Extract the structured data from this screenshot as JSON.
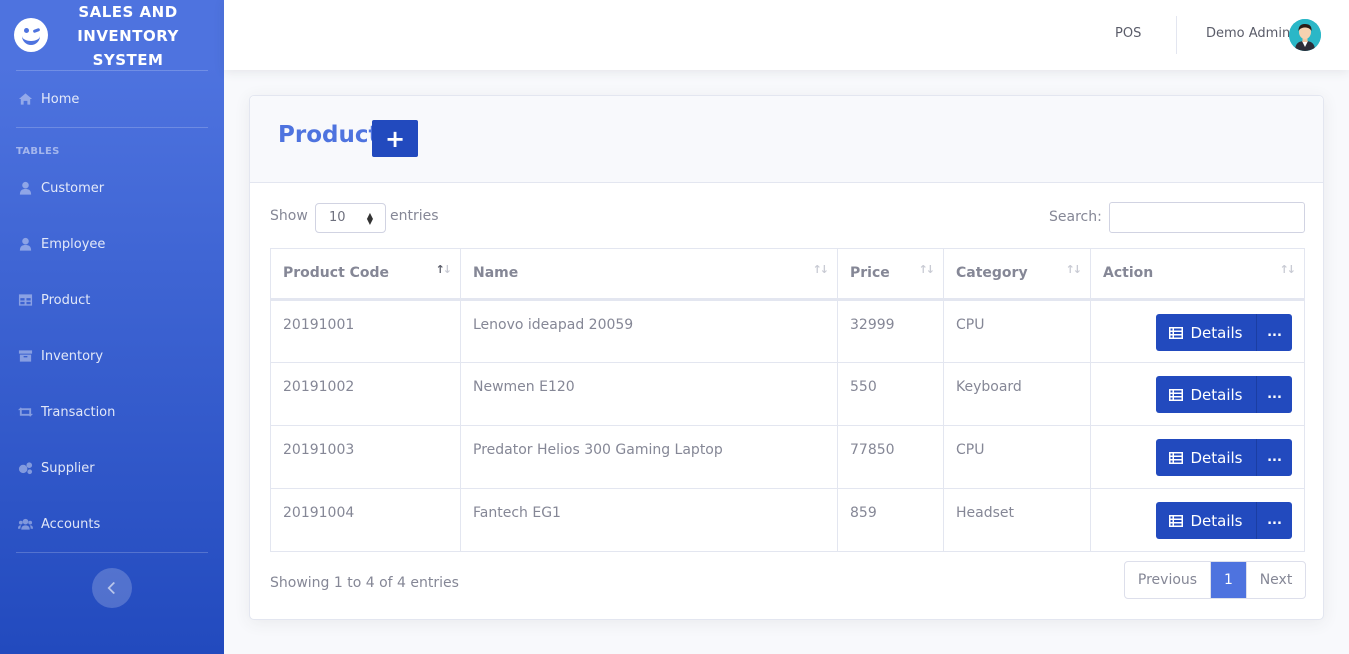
{
  "app": {
    "brand_line1": "SALES AND",
    "brand_line2": "INVENTORY",
    "brand_line3": "SYSTEM"
  },
  "sidebar": {
    "home": "Home",
    "section_heading": "TABLES",
    "items": [
      {
        "label": "Customer",
        "icon": "user-icon"
      },
      {
        "label": "Employee",
        "icon": "user-icon"
      },
      {
        "label": "Product",
        "icon": "table-icon"
      },
      {
        "label": "Inventory",
        "icon": "archive-icon"
      },
      {
        "label": "Transaction",
        "icon": "retweet-icon"
      },
      {
        "label": "Supplier",
        "icon": "cogs-icon"
      },
      {
        "label": "Accounts",
        "icon": "users-icon"
      }
    ]
  },
  "topbar": {
    "pos": "POS",
    "user_name": "Demo Admin"
  },
  "card": {
    "title": "Product",
    "add_button": "+"
  },
  "table_controls": {
    "show": "Show",
    "entries_value": "10",
    "entries": "entries",
    "search": "Search:",
    "search_value": ""
  },
  "table": {
    "columns": [
      "Product Code",
      "Name",
      "Price",
      "Category",
      "Action"
    ],
    "rows": [
      {
        "code": "20191001",
        "name": "Lenovo ideapad 20059",
        "price": "32999",
        "category": "CPU"
      },
      {
        "code": "20191002",
        "name": "Newmen E120",
        "price": "550",
        "category": "Keyboard"
      },
      {
        "code": "20191003",
        "name": "Predator Helios 300 Gaming Laptop",
        "price": "77850",
        "category": "CPU"
      },
      {
        "code": "20191004",
        "name": "Fantech EG1",
        "price": "859",
        "category": "Headset"
      }
    ],
    "details_label": "Details",
    "more_label": "..."
  },
  "footer": {
    "info": "Showing 1 to 4 of 4 entries",
    "previous": "Previous",
    "page": "1",
    "next": "Next"
  },
  "colors": {
    "primary": "#4e73df",
    "primary_dark": "#224abe",
    "text_muted": "#858796"
  }
}
